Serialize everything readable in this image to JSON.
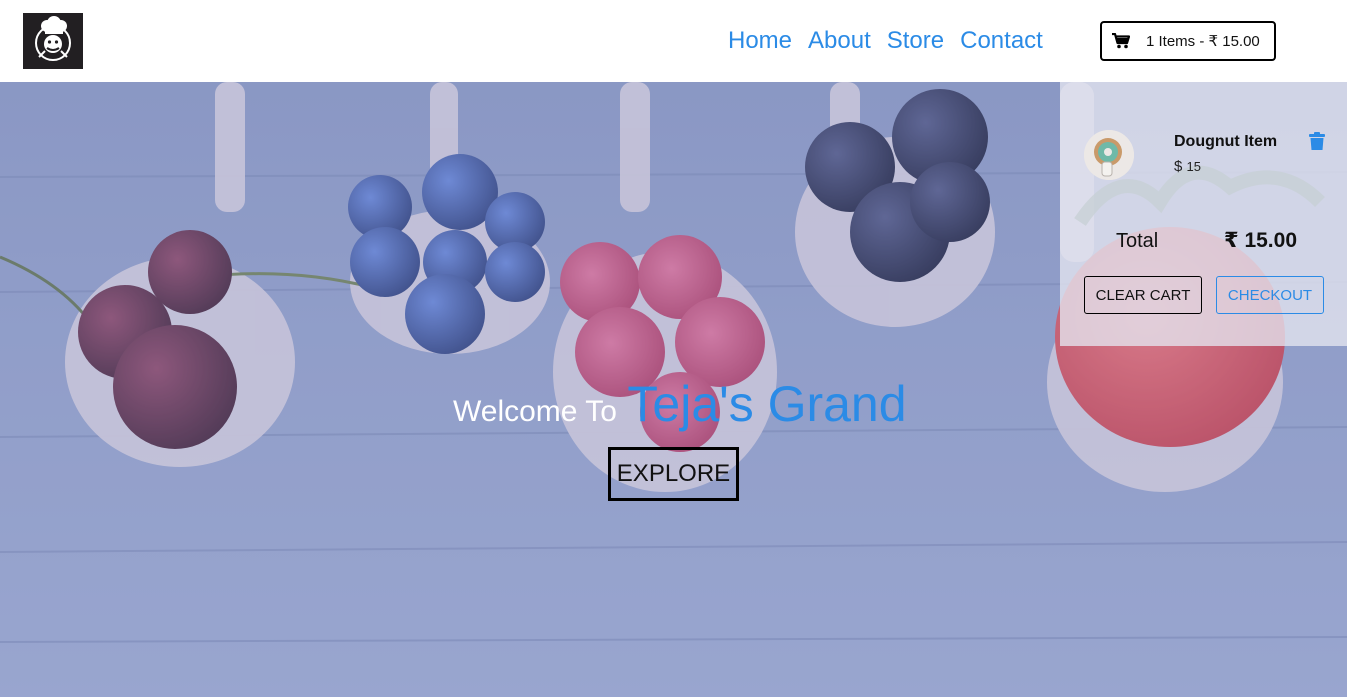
{
  "nav": {
    "links": [
      {
        "label": "Home"
      },
      {
        "label": "About"
      },
      {
        "label": "Store"
      },
      {
        "label": "Contact"
      }
    ],
    "cart_summary": "1 Items - ₹ 15.00"
  },
  "hero": {
    "welcome_prefix": "Welcome To",
    "brand_name": "Teja's Grand",
    "explore_label": "EXPLORE"
  },
  "cart_panel": {
    "item": {
      "name": "Dougnut Item",
      "currency": "$",
      "price": "15"
    },
    "total_label": "Total",
    "total_value": "₹ 15.00",
    "clear_label": "CLEAR CART",
    "checkout_label": "CHECKOUT"
  },
  "icons": {
    "logo": "chef-logo-icon",
    "cart": "shopping-cart-icon",
    "remove": "trash-icon",
    "thumbnail": "doughnut-image"
  },
  "colors": {
    "accent": "#2b8be6",
    "logo_bg": "#221f22"
  }
}
